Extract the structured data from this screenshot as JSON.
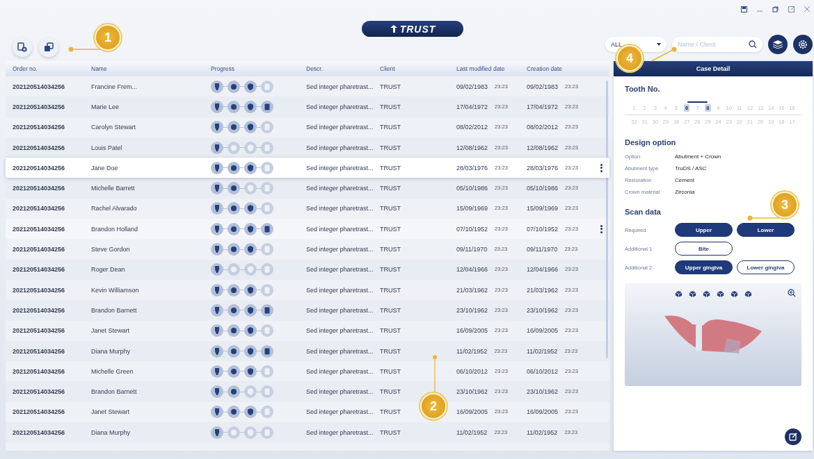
{
  "logo": {
    "text": "TRUST"
  },
  "filter": {
    "value": "ALL"
  },
  "search": {
    "placeholder": "Name / Client"
  },
  "table": {
    "columns": [
      "Order no.",
      "Name",
      "Progress",
      "Descr.",
      "Client",
      "Last modified date",
      "Creation date"
    ],
    "rows": [
      {
        "order": "202120514034256",
        "name": "Francine Frem...",
        "progress": [
          true,
          true,
          true,
          false
        ],
        "descr": "Sed integer pharetrast...",
        "client": "TRUST",
        "modified": "09/02/1983",
        "modified_time": "23:23",
        "created": "09/02/1983",
        "created_time": "23:23",
        "selected": false,
        "highlighted": false
      },
      {
        "order": "202120514034256",
        "name": "Marie Lee",
        "progress": [
          true,
          true,
          true,
          true
        ],
        "descr": "Sed integer pharetrast...",
        "client": "TRUST",
        "modified": "17/04/1972",
        "modified_time": "23:23",
        "created": "17/04/1972",
        "created_time": "23:23",
        "selected": false,
        "highlighted": false
      },
      {
        "order": "202120514034256",
        "name": "Carolyn Stewart",
        "progress": [
          true,
          true,
          true,
          false
        ],
        "descr": "Sed integer pharetrast...",
        "client": "TRUST",
        "modified": "08/02/2012",
        "modified_time": "23:23",
        "created": "08/02/2012",
        "created_time": "23:23",
        "selected": false,
        "highlighted": false
      },
      {
        "order": "202120514034256",
        "name": "Louis Patel",
        "progress": [
          true,
          false,
          false,
          false
        ],
        "descr": "Sed integer pharetrast...",
        "client": "TRUST",
        "modified": "12/08/1962",
        "modified_time": "23:23",
        "created": "12/08/1962",
        "created_time": "23:23",
        "selected": false,
        "highlighted": false
      },
      {
        "order": "202120514034256",
        "name": "Jane Doe",
        "progress": [
          true,
          true,
          true,
          false
        ],
        "descr": "Sed integer pharetrast...",
        "client": "TRUST",
        "modified": "28/03/1976",
        "modified_time": "23:23",
        "created": "28/03/1976",
        "created_time": "23:23",
        "selected": true,
        "highlighted": false
      },
      {
        "order": "202120514034256",
        "name": "Michelle Barrett",
        "progress": [
          true,
          true,
          false,
          false
        ],
        "descr": "Sed integer pharetrast...",
        "client": "TRUST",
        "modified": "05/10/1986",
        "modified_time": "23:23",
        "created": "05/10/1986",
        "created_time": "23:23",
        "selected": false,
        "highlighted": false
      },
      {
        "order": "202120514034256",
        "name": "Rachel Alvarado",
        "progress": [
          true,
          true,
          true,
          false
        ],
        "descr": "Sed integer pharetrast...",
        "client": "TRUST",
        "modified": "15/09/1969",
        "modified_time": "23:23",
        "created": "15/09/1969",
        "created_time": "23:23",
        "selected": false,
        "highlighted": false
      },
      {
        "order": "202120514034256",
        "name": "Brandon Holland",
        "progress": [
          true,
          true,
          true,
          true
        ],
        "descr": "Sed integer pharetrast...",
        "client": "TRUST",
        "modified": "07/10/1952",
        "modified_time": "23:23",
        "created": "07/10/1952",
        "created_time": "23:23",
        "selected": false,
        "highlighted": true
      },
      {
        "order": "202120514034256",
        "name": "Steve Gordon",
        "progress": [
          true,
          true,
          true,
          false
        ],
        "descr": "Sed integer pharetrast...",
        "client": "TRUST",
        "modified": "09/11/1970",
        "modified_time": "23:23",
        "created": "09/11/1970",
        "created_time": "23:23",
        "selected": false,
        "highlighted": false
      },
      {
        "order": "202120514034256",
        "name": "Roger Dean",
        "progress": [
          true,
          false,
          false,
          false
        ],
        "descr": "Sed integer pharetrast...",
        "client": "TRUST",
        "modified": "12/04/1966",
        "modified_time": "23:23",
        "created": "12/04/1966",
        "created_time": "23:23",
        "selected": false,
        "highlighted": false
      },
      {
        "order": "202120514034256",
        "name": "Kevin Williamson",
        "progress": [
          true,
          true,
          true,
          false
        ],
        "descr": "Sed integer pharetrast...",
        "client": "TRUST",
        "modified": "21/03/1962",
        "modified_time": "23:23",
        "created": "21/03/1962",
        "created_time": "23:23",
        "selected": false,
        "highlighted": false
      },
      {
        "order": "202120514034256",
        "name": "Brandon Barnett",
        "progress": [
          true,
          true,
          true,
          true
        ],
        "descr": "Sed integer pharetrast...",
        "client": "TRUST",
        "modified": "23/10/1962",
        "modified_time": "23:23",
        "created": "23/10/1962",
        "created_time": "23:23",
        "selected": false,
        "highlighted": false
      },
      {
        "order": "202120514034256",
        "name": "Janet Stewart",
        "progress": [
          true,
          true,
          true,
          false
        ],
        "descr": "Sed integer pharetrast...",
        "client": "TRUST",
        "modified": "16/09/2005",
        "modified_time": "23:23",
        "created": "16/09/2005",
        "created_time": "23:23",
        "selected": false,
        "highlighted": false
      },
      {
        "order": "202120514034256",
        "name": "Diana Murphy",
        "progress": [
          true,
          true,
          true,
          true
        ],
        "descr": "Sed integer pharetrast...",
        "client": "TRUST",
        "modified": "11/02/1952",
        "modified_time": "23:23",
        "created": "11/02/1952",
        "created_time": "23:23",
        "selected": false,
        "highlighted": false
      },
      {
        "order": "202120514034256",
        "name": "Michelle Green",
        "progress": [
          true,
          true,
          true,
          false
        ],
        "descr": "Sed integer pharetrast...",
        "client": "TRUST",
        "modified": "06/10/2012",
        "modified_time": "23:23",
        "created": "06/10/2012",
        "created_time": "23:23",
        "selected": false,
        "highlighted": false
      },
      {
        "order": "202120514034256",
        "name": "Brandon Barnett",
        "progress": [
          true,
          true,
          false,
          false
        ],
        "descr": "Sed integer pharetrast...",
        "client": "TRUST",
        "modified": "23/10/1962",
        "modified_time": "23:23",
        "created": "23/10/1962",
        "created_time": "23:23",
        "selected": false,
        "highlighted": false
      },
      {
        "order": "202120514034256",
        "name": "Janet Stewart",
        "progress": [
          true,
          true,
          true,
          false
        ],
        "descr": "Sed integer pharetrast...",
        "client": "TRUST",
        "modified": "16/09/2005",
        "modified_time": "23:23",
        "created": "16/09/2005",
        "created_time": "23:23",
        "selected": false,
        "highlighted": false
      },
      {
        "order": "202120514034256",
        "name": "Diana Murphy",
        "progress": [
          true,
          false,
          false,
          false
        ],
        "descr": "Sed integer pharetrast...",
        "client": "TRUST",
        "modified": "11/02/1952",
        "modified_time": "23:23",
        "created": "11/02/1952",
        "created_time": "23:23",
        "selected": false,
        "highlighted": false
      }
    ]
  },
  "case_detail": {
    "title": "Case Detail",
    "tooth_title": "Tooth No.",
    "upper_teeth": [
      {
        "n": "1",
        "selected": false
      },
      {
        "n": "2",
        "selected": false
      },
      {
        "n": "3",
        "selected": false
      },
      {
        "n": "4",
        "selected": false
      },
      {
        "n": "5",
        "selected": false
      },
      {
        "n": "6",
        "selected": true
      },
      {
        "n": "7",
        "selected": false
      },
      {
        "n": "8",
        "selected": true
      },
      {
        "n": "9",
        "selected": false
      },
      {
        "n": "10",
        "selected": false
      },
      {
        "n": "11",
        "selected": false
      },
      {
        "n": "12",
        "selected": false
      },
      {
        "n": "13",
        "selected": false
      },
      {
        "n": "14",
        "selected": false
      },
      {
        "n": "15",
        "selected": false
      },
      {
        "n": "16",
        "selected": false
      }
    ],
    "lower_teeth": [
      {
        "n": "32",
        "selected": false
      },
      {
        "n": "31",
        "selected": false
      },
      {
        "n": "30",
        "selected": false
      },
      {
        "n": "29",
        "selected": false
      },
      {
        "n": "28",
        "selected": false
      },
      {
        "n": "27",
        "selected": false
      },
      {
        "n": "26",
        "selected": false
      },
      {
        "n": "25",
        "selected": false
      },
      {
        "n": "24",
        "selected": false
      },
      {
        "n": "23",
        "selected": false
      },
      {
        "n": "22",
        "selected": false
      },
      {
        "n": "21",
        "selected": false
      },
      {
        "n": "20",
        "selected": false
      },
      {
        "n": "19",
        "selected": false
      },
      {
        "n": "18",
        "selected": false
      },
      {
        "n": "17",
        "selected": false
      }
    ],
    "design_title": "Design option",
    "design": [
      {
        "label": "Option",
        "value": "Abutment + Crown"
      },
      {
        "label": "Abutment type",
        "value": "TruDS / ASC"
      },
      {
        "label": "Restoration",
        "value": "Cement"
      },
      {
        "label": "Crown material",
        "value": "Zirconia"
      }
    ],
    "scan_title": "Scan data",
    "scan": [
      {
        "label": "Required",
        "buttons": [
          {
            "text": "Upper",
            "selected": true
          },
          {
            "text": "Lower",
            "selected": true
          }
        ]
      },
      {
        "label": "Additional 1",
        "buttons": [
          {
            "text": "Bite",
            "selected": false
          }
        ]
      },
      {
        "label": "Additional 2",
        "buttons": [
          {
            "text": "Upper gingiva",
            "selected": true
          },
          {
            "text": "Lower gingiva",
            "selected": false
          }
        ]
      }
    ]
  },
  "callouts": [
    {
      "text": "1"
    },
    {
      "text": "2"
    },
    {
      "text": "3"
    },
    {
      "text": "4"
    }
  ]
}
